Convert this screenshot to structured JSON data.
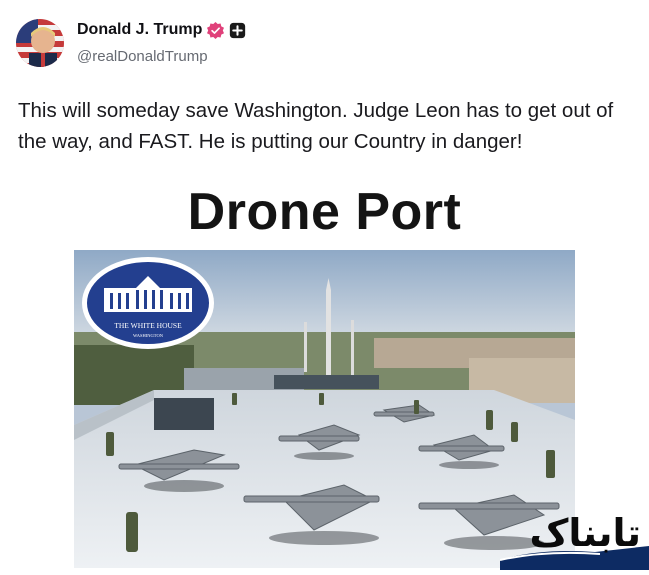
{
  "author": {
    "display_name": "Donald J. Trump",
    "handle": "@realDonaldTrump",
    "avatar_icon": "flag-portrait-avatar",
    "verified_icon": "verified-badge-icon",
    "verified_color": "#e0417a",
    "extra_badge_icon": "plus-badge-icon"
  },
  "post": {
    "text": "This will someday save Washington. Judge Leon has to get out of the way, and FAST. He is putting our Country in danger!"
  },
  "media": {
    "title": "Drone Port",
    "seal": {
      "line1": "THE WHITE HOUSE",
      "line2": "WASHINGTON"
    },
    "description_icon": "rooftop-drone-photo"
  },
  "watermark": {
    "text": "تابناک"
  }
}
